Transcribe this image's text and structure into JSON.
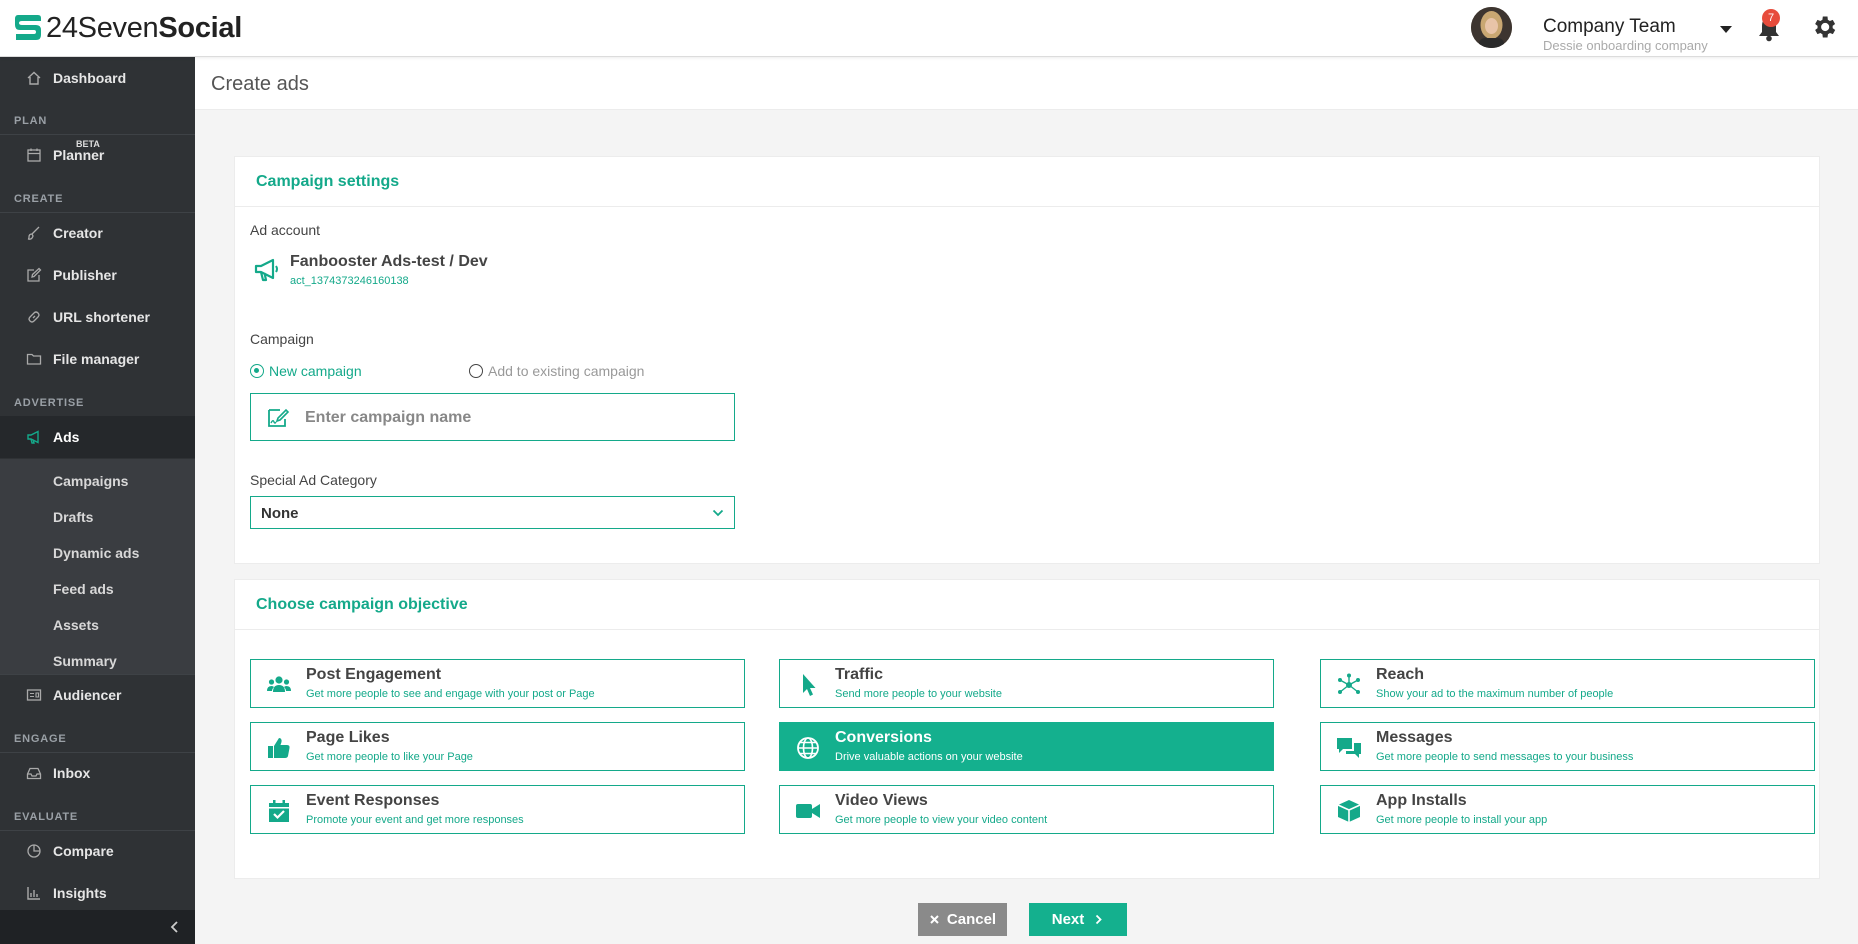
{
  "header": {
    "logo_regular": "24Seven",
    "logo_bold": "Social",
    "team_name": "Company Team",
    "team_subtitle": "Dessie onboarding company",
    "notification_count": "7",
    "icons": [
      "s-logo-icon",
      "avatar",
      "caret-down-icon",
      "bell-icon",
      "gear-icon"
    ]
  },
  "sidebar": {
    "dashboard": "Dashboard",
    "sections": {
      "plan": "PLAN",
      "create": "CREATE",
      "advertise": "ADVERTISE",
      "engage": "ENGAGE",
      "evaluate": "EVALUATE"
    },
    "planner": "Planner",
    "planner_badge": "BETA",
    "creator": "Creator",
    "publisher": "Publisher",
    "url_shortener": "URL shortener",
    "file_manager": "File  manager",
    "ads": "Ads",
    "ads_sub": [
      "Campaigns",
      "Drafts",
      "Dynamic ads",
      "Feed ads",
      "Assets",
      "Summary"
    ],
    "audiencer": "Audiencer",
    "inbox": "Inbox",
    "compare": "Compare",
    "insights": "Insights"
  },
  "page": {
    "title": "Create ads"
  },
  "campaign_settings": {
    "heading": "Campaign settings",
    "ad_account_label": "Ad account",
    "ad_account_name": "Fanbooster Ads-test / Dev",
    "ad_account_id": "act_1374373246160138",
    "campaign_label": "Campaign",
    "radio_new": "New campaign",
    "radio_existing": "Add to existing campaign",
    "name_placeholder": "Enter campaign name",
    "name_value": "",
    "special_category_label": "Special Ad Category",
    "special_category_value": "None"
  },
  "objective": {
    "heading": "Choose campaign objective",
    "selected": "Conversions",
    "items": [
      {
        "title": "Post Engagement",
        "desc": "Get more people to see and engage with your post or Page",
        "icon": "people-group-icon"
      },
      {
        "title": "Traffic",
        "desc": "Send more people to your website",
        "icon": "cursor-icon"
      },
      {
        "title": "Reach",
        "desc": "Show your ad to the maximum number of people",
        "icon": "network-icon"
      },
      {
        "title": "Page Likes",
        "desc": "Get more people to like your Page",
        "icon": "thumbs-up-icon"
      },
      {
        "title": "Conversions",
        "desc": "Drive valuable actions on your website",
        "icon": "globe-icon"
      },
      {
        "title": "Messages",
        "desc": "Get more people to send messages to your business",
        "icon": "chat-bubbles-icon"
      },
      {
        "title": "Event Responses",
        "desc": "Promote your event and get more responses",
        "icon": "calendar-check-icon"
      },
      {
        "title": "Video Views",
        "desc": "Get more people to view your video content",
        "icon": "video-camera-icon"
      },
      {
        "title": "App Installs",
        "desc": "Get more people to install your app",
        "icon": "cube-icon"
      }
    ]
  },
  "actions": {
    "cancel": "Cancel",
    "next": "Next"
  },
  "colors": {
    "accent": "#14a98a",
    "sidebar_bg": "#2f3235",
    "cancel_bg": "#8a8a8a",
    "badge": "#e74c3c"
  }
}
